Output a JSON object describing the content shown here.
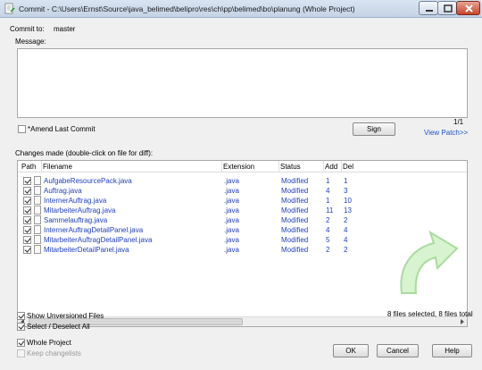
{
  "window": {
    "title": "Commit - C:\\Users\\Ernst\\Source\\java_belimed\\belipro\\res\\ch\\pp\\belimed\\bo\\planung (Whole Project)"
  },
  "commit_to": {
    "label": "Commit to:",
    "value": "master"
  },
  "message": {
    "label": "Message:",
    "value": ""
  },
  "amend": {
    "label": "*Amend Last Commit",
    "checked": false
  },
  "sign_button": "Sign",
  "page_counter": "1/1",
  "view_patch_link": "View Patch>>",
  "changes": {
    "label": "Changes made (double-click on file for diff):",
    "columns": [
      "Path",
      "Filename",
      "Extension",
      "Status",
      "Add",
      "Del"
    ],
    "rows": [
      {
        "checked": true,
        "filename": "AufgabeResourcePack.java",
        "extension": ".java",
        "status": "Modified",
        "add": "1",
        "del": "1"
      },
      {
        "checked": true,
        "filename": "Auftrag.java",
        "extension": ".java",
        "status": "Modified",
        "add": "4",
        "del": "3"
      },
      {
        "checked": true,
        "filename": "InternerAuftrag.java",
        "extension": ".java",
        "status": "Modified",
        "add": "1",
        "del": "10"
      },
      {
        "checked": true,
        "filename": "MitarbeiterAuftrag.java",
        "extension": ".java",
        "status": "Modified",
        "add": "11",
        "del": "13"
      },
      {
        "checked": true,
        "filename": "Sammelauftrag.java",
        "extension": ".java",
        "status": "Modified",
        "add": "2",
        "del": "2"
      },
      {
        "checked": true,
        "filename": "InternerAuftragDetailPanel.java",
        "extension": ".java",
        "status": "Modified",
        "add": "4",
        "del": "4"
      },
      {
        "checked": true,
        "filename": "MitarbeiterAuftragDetailPanel.java",
        "extension": ".java",
        "status": "Modified",
        "add": "5",
        "del": "4"
      },
      {
        "checked": true,
        "filename": "MitarbeiterDetailPanel.java",
        "extension": ".java",
        "status": "Modified",
        "add": "2",
        "del": "2"
      }
    ]
  },
  "show_unversioned": {
    "label": "Show Unversioned Files",
    "checked": true
  },
  "select_all": {
    "label": "Select / Deselect All",
    "checked": true
  },
  "selection_summary": "8 files selected, 8 files total",
  "whole_project": {
    "label": "Whole Project",
    "checked": true
  },
  "keep_changelists": {
    "label": "Keep changelists",
    "checked": false,
    "enabled": false
  },
  "buttons": {
    "ok": "OK",
    "cancel": "Cancel",
    "help": "Help"
  },
  "colors": {
    "link": "#1f55c6",
    "file_text": "#1f3fb8",
    "titlebar": "#c4d3e6"
  },
  "icons": {
    "title": "tortoisegit-commit-icon",
    "watermark": "commit-arrow-icon"
  }
}
